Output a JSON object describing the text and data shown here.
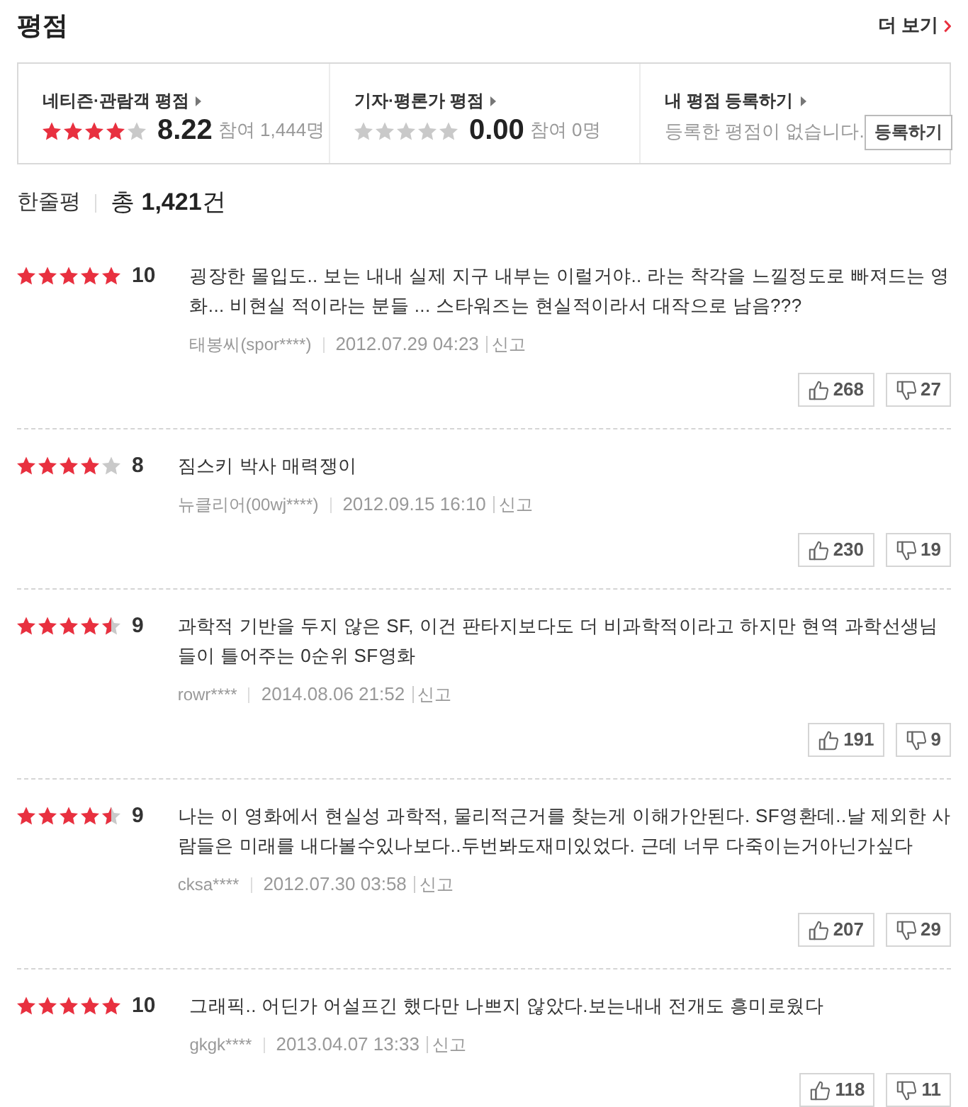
{
  "section": {
    "title": "평점",
    "more_link": "더 보기"
  },
  "summary": [
    {
      "kind": "rating",
      "label": "네티즌·관람객 평점",
      "stars": 4,
      "score": "8.22",
      "participants": "참여 1,444명"
    },
    {
      "kind": "rating",
      "label": "기자·평론가 평점",
      "stars": 0,
      "score": "0.00",
      "participants": "참여 0명"
    },
    {
      "kind": "register",
      "label": "내 평점 등록하기",
      "message": "등록한 평점이 없습니다.",
      "button": "등록하기"
    }
  ],
  "comments_header": {
    "title": "한줄평",
    "total": "총 **1,421**건"
  },
  "reviews": [
    {
      "stars": 5,
      "score": "10",
      "text": "굉장한 몰입도.. 보는 내내 실제 지구 내부는 이럴거야.. 라는 착각을 느낄정도로 빠져드는 영화... 비현실 적이라는 분들 ... 스타워즈는 현실적이라서 대작으로 남음???",
      "author": "태봉씨(spor****)",
      "date": "2012.07.29 04:23",
      "report": "신고",
      "likes": "268",
      "dislikes": "27"
    },
    {
      "stars": 4,
      "score": "8",
      "text": "짐스키 박사 매력쟁이",
      "author": "뉴클리어(00wj****)",
      "date": "2012.09.15 16:10",
      "report": "신고",
      "likes": "230",
      "dislikes": "19"
    },
    {
      "stars": 4.5,
      "score": "9",
      "text": "과학적 기반을 두지 않은 SF, 이건 판타지보다도 더 비과학적이라고 하지만 현역 과학선생님들이 틀어주는 0순위 SF영화",
      "author": "rowr****",
      "date": "2014.08.06 21:52",
      "report": "신고",
      "likes": "191",
      "dislikes": "9"
    },
    {
      "stars": 4.5,
      "score": "9",
      "text": "나는 이 영화에서 현실성 과학적, 물리적근거를 찾는게 이해가안된다. SF영환데..날 제외한 사람들은 미래를 내다볼수있나보다..두번봐도재미있었다. 근데 너무 다죽이는거아닌가싶다",
      "author": "cksa****",
      "date": "2012.07.30 03:58",
      "report": "신고",
      "likes": "207",
      "dislikes": "29"
    },
    {
      "stars": 5,
      "score": "10",
      "text": "그래픽.. 어딘가 어설프긴 했다만 나쁘지 않았다.보는내내 전개도 흥미로웠다",
      "author": "gkgk****",
      "date": "2013.04.07 13:33",
      "report": "신고",
      "likes": "118",
      "dislikes": "11"
    }
  ]
}
